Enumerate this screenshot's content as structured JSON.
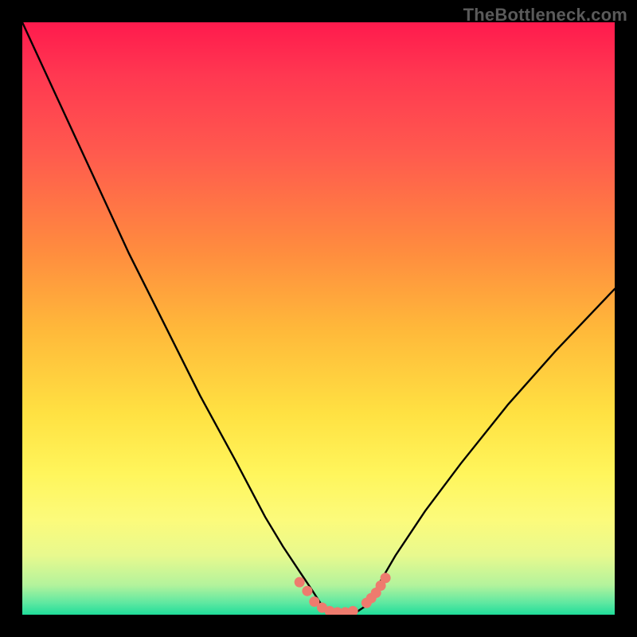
{
  "watermark": {
    "text": "TheBottleneck.com"
  },
  "chart_data": {
    "type": "line",
    "title": "",
    "xlabel": "",
    "ylabel": "",
    "series": [
      {
        "name": "curve",
        "x": [
          0.0,
          0.06,
          0.12,
          0.18,
          0.24,
          0.3,
          0.36,
          0.41,
          0.44,
          0.47,
          0.49,
          0.505,
          0.52,
          0.54,
          0.565,
          0.58,
          0.595,
          0.63,
          0.68,
          0.74,
          0.82,
          0.9,
          1.0
        ],
        "y": [
          1.0,
          0.87,
          0.74,
          0.61,
          0.49,
          0.37,
          0.26,
          0.165,
          0.115,
          0.07,
          0.04,
          0.017,
          0.005,
          0.002,
          0.005,
          0.015,
          0.04,
          0.1,
          0.175,
          0.255,
          0.355,
          0.445,
          0.55
        ]
      },
      {
        "name": "markers",
        "style": "points",
        "x": [
          0.468,
          0.481,
          0.493,
          0.506,
          0.519,
          0.532,
          0.545,
          0.558,
          0.581,
          0.589,
          0.597,
          0.605,
          0.613
        ],
        "y": [
          0.055,
          0.04,
          0.022,
          0.012,
          0.006,
          0.004,
          0.004,
          0.006,
          0.02,
          0.028,
          0.037,
          0.049,
          0.062
        ]
      }
    ],
    "xlim": [
      0,
      1
    ],
    "ylim": [
      0,
      1
    ],
    "marker_color": "#ee7b6e",
    "curve_color": "#000000"
  }
}
